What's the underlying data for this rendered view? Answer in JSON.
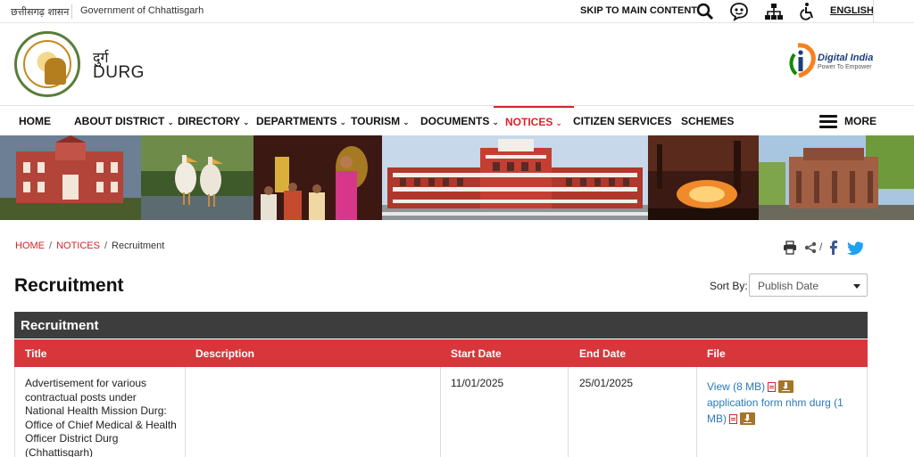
{
  "topbar": {
    "hindi_label": "छत्तीसगढ़ शासन",
    "government": "Government of Chhattisgarh",
    "skip_link": "SKIP TO MAIN CONTENT",
    "language": "ENGLISH",
    "icons": [
      "search-icon",
      "sitemap-chat-icon",
      "sitemap-icon",
      "accessibility-icon"
    ]
  },
  "header": {
    "site_hindi": "दुर्ग",
    "site_name": "DURG",
    "partner_logo": {
      "name": "Digital India",
      "tagline": "Power To Empower"
    }
  },
  "nav": {
    "items": [
      {
        "label": "HOME",
        "dropdown": false
      },
      {
        "label": "ABOUT DISTRICT",
        "dropdown": true
      },
      {
        "label": "DIRECTORY",
        "dropdown": true
      },
      {
        "label": "DEPARTMENTS",
        "dropdown": true
      },
      {
        "label": "TOURISM",
        "dropdown": true
      },
      {
        "label": "DOCUMENTS",
        "dropdown": true
      },
      {
        "label": "NOTICES",
        "dropdown": true,
        "active": true
      },
      {
        "label": "CITIZEN SERVICES",
        "dropdown": false
      },
      {
        "label": "SCHEMES",
        "dropdown": false
      }
    ],
    "more_label": "MORE",
    "chevron": "⌄",
    "accent_color": "#d8232a"
  },
  "breadcrumb": {
    "home": "HOME",
    "notices": "NOTICES",
    "current": "Recruitment",
    "separator": "/"
  },
  "share": {
    "icons": [
      "print-icon",
      "share-icon",
      "facebook-icon",
      "twitter-icon"
    ],
    "separator": "/"
  },
  "page": {
    "title": "Recruitment",
    "sort_label": "Sort By:",
    "sort_value": "Publish Date"
  },
  "table": {
    "caption": "Recruitment",
    "header_color": "#d8363b",
    "columns": [
      "Title",
      "Description",
      "Start Date",
      "End Date",
      "File"
    ],
    "rows": [
      {
        "title": "Advertisement for various contractual posts under National Health Mission Durg: Office of Chief Medical & Health Officer District Durg (Chhattisgarh)",
        "description": "",
        "start_date": "11/01/2025",
        "end_date": "25/01/2025",
        "files": [
          {
            "label": "View (8 MB)"
          },
          {
            "label": "application form nhm durg (1 MB)"
          }
        ]
      }
    ]
  }
}
